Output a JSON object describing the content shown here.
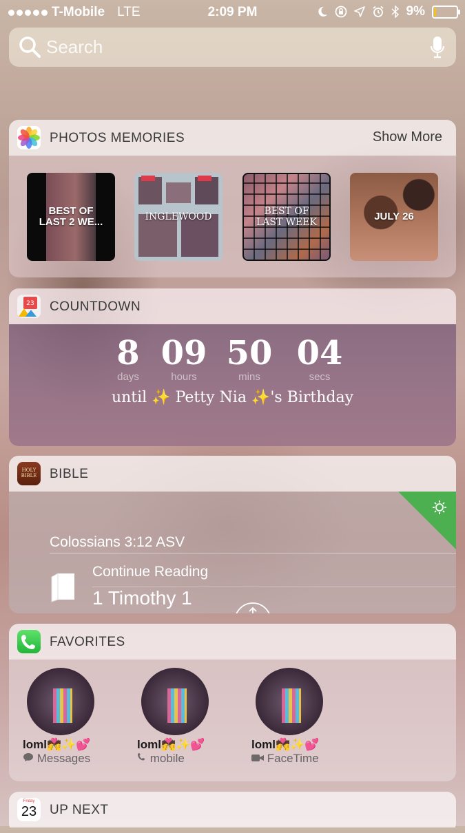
{
  "status_bar": {
    "carrier": "T-Mobile",
    "network": "LTE",
    "time": "2:09 PM",
    "battery": "9%",
    "battery_level": 0.09
  },
  "search": {
    "placeholder": "Search"
  },
  "photos_widget": {
    "title": "PHOTOS MEMORIES",
    "action": "Show More",
    "memories": [
      {
        "label": "BEST OF\nLAST 2 WE..."
      },
      {
        "label": "INGLEWOOD"
      },
      {
        "label": "BEST OF\nLAST WEEK"
      },
      {
        "label": "JULY 26"
      }
    ]
  },
  "countdown_widget": {
    "title": "COUNTDOWN",
    "icon_text": "Jan 23",
    "units": [
      {
        "value": "8",
        "label": "days"
      },
      {
        "value": "09",
        "label": "hours"
      },
      {
        "value": "50",
        "label": "mins"
      },
      {
        "value": "04",
        "label": "secs"
      }
    ],
    "until": "until ✨ Petty Nia ✨'s Birthday"
  },
  "bible_widget": {
    "title": "BIBLE",
    "icon_text": "HOLY BIBLE",
    "verse": "Colossians 3:12 ASV",
    "continue_label": "Continue Reading",
    "book": "1 Timothy 1"
  },
  "favorites_widget": {
    "title": "FAVORITES",
    "contacts": [
      {
        "name": "loml💏✨💕",
        "method": "Messages"
      },
      {
        "name": "loml💏✨💕",
        "method": "mobile"
      },
      {
        "name": "loml💏✨💕",
        "method": "FaceTime"
      }
    ]
  },
  "upnext_widget": {
    "title": "UP NEXT",
    "day_name": "Friday",
    "day_number": "23"
  }
}
